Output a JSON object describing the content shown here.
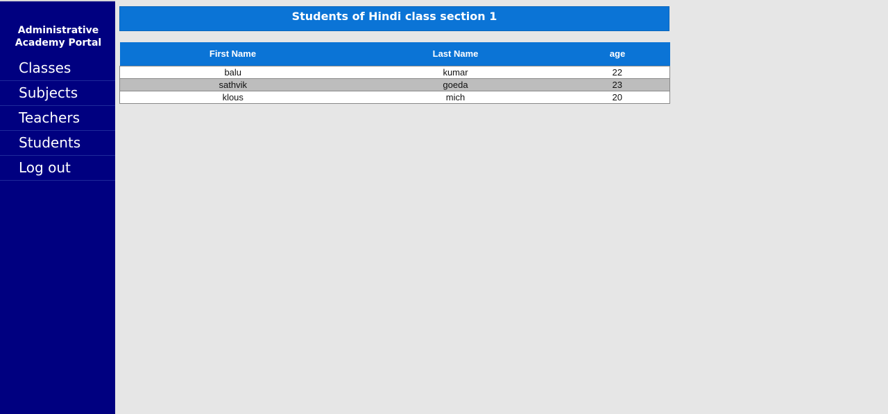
{
  "sidebar": {
    "brand_line1": "Administrative",
    "brand_line2": "Academy Portal",
    "items": [
      {
        "label": "Classes"
      },
      {
        "label": "Subjects"
      },
      {
        "label": "Teachers"
      },
      {
        "label": "Students"
      },
      {
        "label": "Log out"
      }
    ]
  },
  "main": {
    "title": "Students of Hindi class section 1",
    "table": {
      "headers": [
        "First Name",
        "Last Name",
        "age"
      ],
      "rows": [
        [
          "balu",
          "kumar",
          "22"
        ],
        [
          "sathvik",
          "goeda",
          "23"
        ],
        [
          "klous",
          "mich",
          "20"
        ]
      ]
    }
  },
  "colors": {
    "sidebar_bg": "#000080",
    "header_bg": "#0b74d6",
    "page_bg": "#e6e6e6",
    "alt_row_bg": "#bdbdbd"
  }
}
